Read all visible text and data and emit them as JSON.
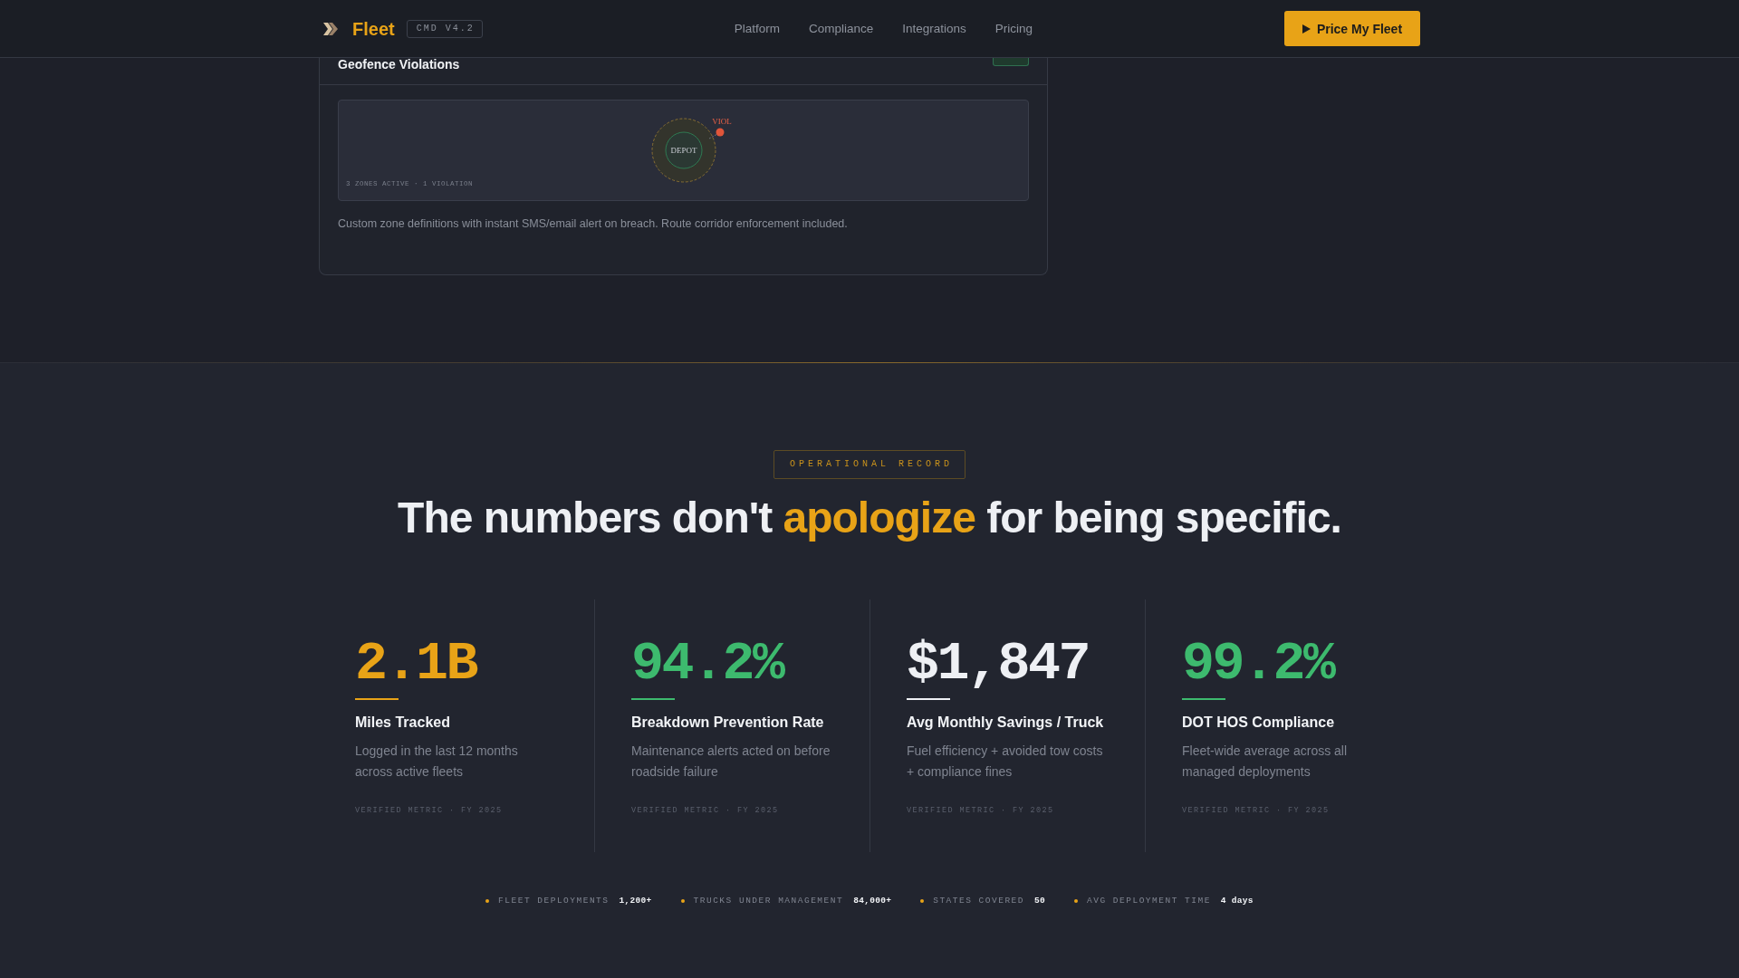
{
  "header": {
    "brand": "Fleet",
    "version": "CMD V4.2",
    "nav": [
      {
        "label": "Platform"
      },
      {
        "label": "Compliance"
      },
      {
        "label": "Integrations"
      },
      {
        "label": "Pricing"
      }
    ],
    "cta": "Price My Fleet"
  },
  "feature_card": {
    "title": "Geofence Violations",
    "map": {
      "zone_label": "DEPOT",
      "violation_label": "VIOL",
      "caption": "3 ZONES ACTIVE · 1 VIOLATION"
    },
    "description": "Custom zone definitions with instant SMS/email alert on breach. Route corridor enforcement included."
  },
  "record": {
    "eyebrow": "OPERATIONAL RECORD",
    "heading": [
      {
        "text": "The numbers don't ",
        "highlight": false
      },
      {
        "text": "apologize",
        "highlight": true
      },
      {
        "text": " for being specific.",
        "highlight": false
      }
    ],
    "stats": [
      {
        "value": "2.1B",
        "color": "#e8a317",
        "title": "Miles Tracked",
        "description": "Logged in the last 12 months across active fleets",
        "footnote": "VERIFIED METRIC · FY 2025"
      },
      {
        "value": "94.2%",
        "color": "#3dba6e",
        "title": "Breakdown Prevention Rate",
        "description": "Maintenance alerts acted on before roadside failure",
        "footnote": "VERIFIED METRIC · FY 2025"
      },
      {
        "value": "$1,847",
        "color": "#eef0f4",
        "title": "Avg Monthly Savings / Truck",
        "description": "Fuel efficiency + avoided tow costs + compliance fines",
        "footnote": "VERIFIED METRIC · FY 2025"
      },
      {
        "value": "99.2%",
        "color": "#3dba6e",
        "title": "DOT HOS Compliance",
        "description": "Fleet-wide average across all managed deployments",
        "footnote": "VERIFIED METRIC · FY 2025"
      }
    ],
    "summary": [
      {
        "label": "FLEET DEPLOYMENTS",
        "value": "1,200+"
      },
      {
        "label": "TRUCKS UNDER MANAGEMENT",
        "value": "84,000+"
      },
      {
        "label": "STATES COVERED",
        "value": "50"
      },
      {
        "label": "AVG DEPLOYMENT TIME",
        "value": "4 days"
      }
    ]
  }
}
